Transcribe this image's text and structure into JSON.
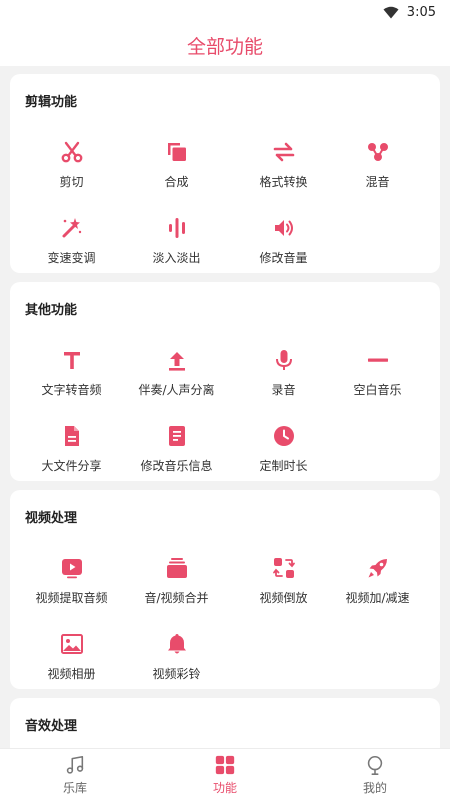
{
  "status_bar": {
    "time": "3:05"
  },
  "header": {
    "title": "全部功能"
  },
  "sections": [
    {
      "title": "剪辑功能",
      "items": [
        {
          "label": "剪切",
          "icon": "scissors-icon"
        },
        {
          "label": "合成",
          "icon": "merge-icon"
        },
        {
          "label": "格式转换",
          "icon": "swap-arrows-icon"
        },
        {
          "label": "混音",
          "icon": "mix-nodes-icon"
        },
        {
          "label": "变速变调",
          "icon": "magic-wand-icon"
        },
        {
          "label": "淡入淡出",
          "icon": "waveform-icon"
        },
        {
          "label": "修改音量",
          "icon": "volume-icon"
        }
      ]
    },
    {
      "title": "其他功能",
      "items": [
        {
          "label": "文字转音频",
          "icon": "text-t-icon"
        },
        {
          "label": "伴奏/人声分离",
          "icon": "upload-icon"
        },
        {
          "label": "录音",
          "icon": "microphone-icon"
        },
        {
          "label": "空白音乐",
          "icon": "minus-icon"
        },
        {
          "label": "大文件分享",
          "icon": "file-icon"
        },
        {
          "label": "修改音乐信息",
          "icon": "document-icon"
        },
        {
          "label": "定制时长",
          "icon": "clock-icon"
        }
      ]
    },
    {
      "title": "视频处理",
      "items": [
        {
          "label": "视频提取音频",
          "icon": "video-play-icon"
        },
        {
          "label": "音/视频合并",
          "icon": "layers-icon"
        },
        {
          "label": "视频倒放",
          "icon": "reverse-icon"
        },
        {
          "label": "视频加/减速",
          "icon": "rocket-icon"
        },
        {
          "label": "视频相册",
          "icon": "photo-album-icon"
        },
        {
          "label": "视频彩铃",
          "icon": "bell-icon"
        }
      ]
    },
    {
      "title": "音效处理",
      "items": []
    }
  ],
  "bottom_nav": [
    {
      "label": "乐库",
      "icon": "music-note-icon",
      "active": false
    },
    {
      "label": "功能",
      "icon": "grid-icon",
      "active": true
    },
    {
      "label": "我的",
      "icon": "profile-icon",
      "active": false
    }
  ],
  "colors": {
    "accent": "#e84c6b",
    "background": "#f2f2f2",
    "card": "#ffffff"
  }
}
